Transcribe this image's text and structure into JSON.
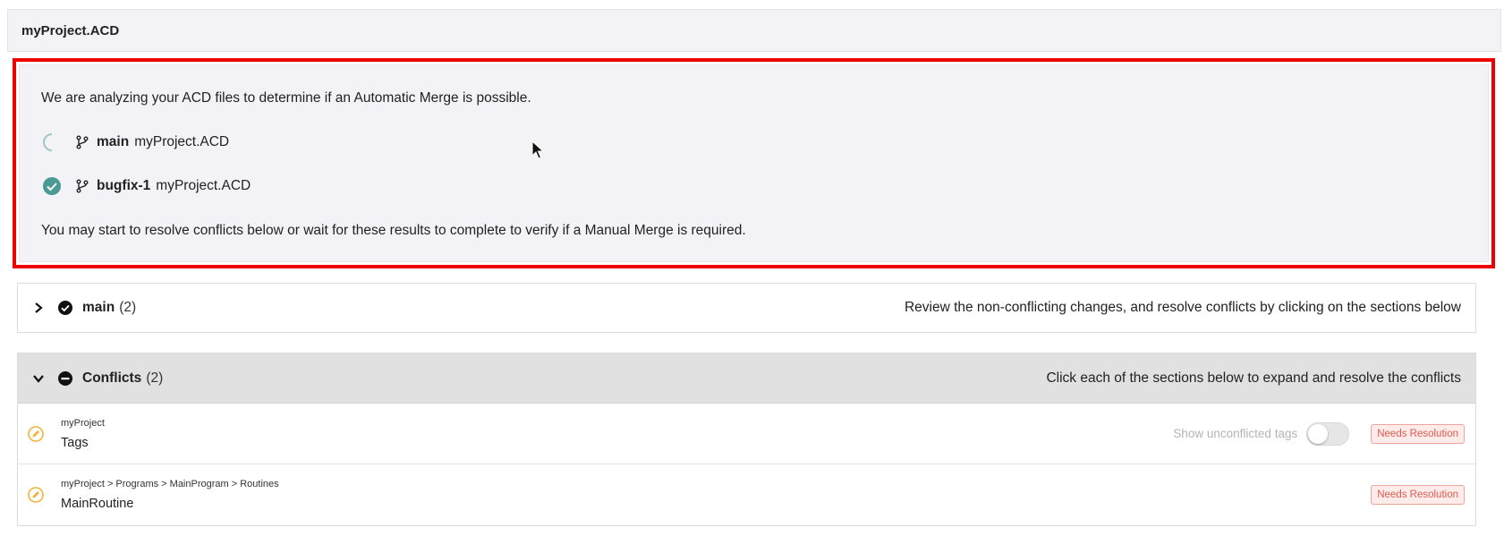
{
  "header": {
    "title": "myProject.ACD"
  },
  "analysis": {
    "intro": "We are analyzing your ACD files to determine if an Automatic Merge is possible.",
    "branches": [
      {
        "status_icon": "spinner-icon",
        "name": "main",
        "file": "myProject.ACD"
      },
      {
        "status_icon": "check-circle-icon",
        "name": "bugfix-1",
        "file": "myProject.ACD"
      }
    ],
    "footer": "You may start to resolve conflicts below or wait for these results to complete to verify if a Manual Merge is required."
  },
  "main_section": {
    "label": "main",
    "count": "(2)",
    "hint": "Review the non-conflicting changes, and resolve conflicts by clicking on the sections below"
  },
  "conflicts_section": {
    "label": "Conflicts",
    "count": "(2)",
    "hint": "Click each of the sections below to expand and resolve the conflicts",
    "items": [
      {
        "path": "myProject",
        "name": "Tags",
        "toggle_label": "Show unconflicted tags",
        "toggle_on": false,
        "badge": "Needs Resolution"
      },
      {
        "path": "myProject > Programs > MainProgram > Routines",
        "name": "MainRoutine",
        "badge": "Needs Resolution"
      }
    ]
  },
  "colors": {
    "highlight_border": "#ee0000",
    "success_teal": "#4a9a94",
    "warning_orange": "#f2b33d",
    "badge_red": "#e05a52"
  }
}
